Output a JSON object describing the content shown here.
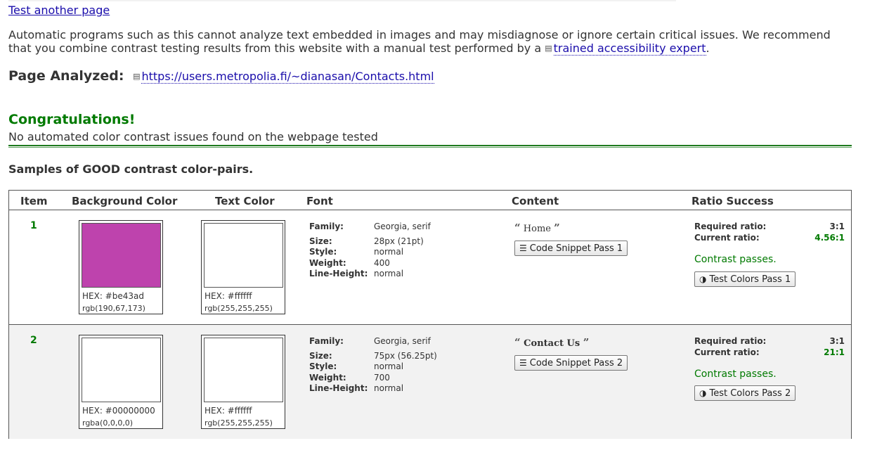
{
  "top_link": "Test another page",
  "disclaimer": {
    "text": "Automatic programs such as this cannot analyze text embedded in images and may misdiagnose or ignore certain critical issues. We recommend that you combine contrast testing results from this website with a manual test performed by a",
    "link": "trained accessibility expert",
    "end": "."
  },
  "analyzed": {
    "label": "Page Analyzed:",
    "url": "https://users.metropolia.fi/~dianasan/Contacts.html"
  },
  "result": {
    "title": "Congratulations!",
    "message": "No automated color contrast issues found on the webpage tested"
  },
  "samples_heading": "Samples of GOOD contrast color-pairs.",
  "table": {
    "headers": {
      "item": "Item",
      "background": "Background Color",
      "text": "Text Color",
      "font": "Font",
      "content": "Content",
      "ratio": "Ratio Success"
    },
    "font_labels": {
      "family": "Family:",
      "size": "Size:",
      "style": "Style:",
      "weight": "Weight:",
      "line_height": "Line-Height:"
    },
    "ratio_labels": {
      "required": "Required ratio:",
      "current": "Current ratio:"
    },
    "rows": [
      {
        "item": "1",
        "bg_color": "#be43ad",
        "bg_hex": "HEX: #be43ad",
        "bg_rgb": "rgb(190,67,173)",
        "text_color": "#ffffff",
        "text_hex": "HEX: #ffffff",
        "text_rgb": "rgb(255,255,255)",
        "family": "Georgia, serif",
        "size": "28px (21pt)",
        "style": "normal",
        "weight": "400",
        "line_height": "normal",
        "content": "Home",
        "snippet_button": "Code Snippet Pass 1",
        "required_ratio": "3:1",
        "current_ratio": "4.56:1",
        "status": "Contrast passes.",
        "test_button": "Test Colors Pass 1"
      },
      {
        "item": "2",
        "bg_color": "#ffffff",
        "bg_hex": "HEX: #00000000",
        "bg_rgb": "rgba(0,0,0,0)",
        "text_color": "#ffffff",
        "text_hex": "HEX: #ffffff",
        "text_rgb": "rgb(255,255,255)",
        "family": "Georgia, serif",
        "size": "75px (56.25pt)",
        "style": "normal",
        "weight": "700",
        "line_height": "normal",
        "content": "Contact Us",
        "snippet_button": "Code Snippet Pass 2",
        "required_ratio": "3:1",
        "current_ratio": "21:1",
        "status": "Contrast passes.",
        "test_button": "Test Colors Pass 2"
      }
    ]
  }
}
